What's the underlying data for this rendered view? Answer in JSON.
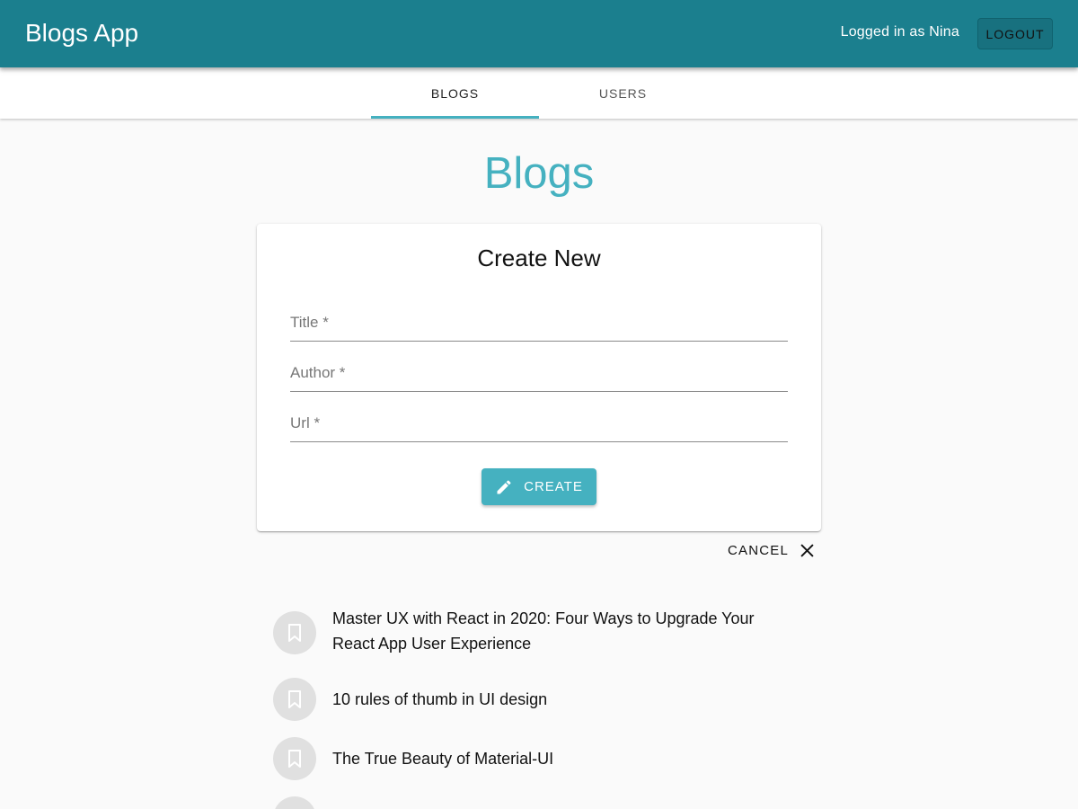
{
  "appbar": {
    "title": "Blogs App",
    "logged_in_text": "Logged in as Nina",
    "logout_label": "LOGOUT"
  },
  "tabs": [
    {
      "label": "BLOGS",
      "selected": true
    },
    {
      "label": "USERS",
      "selected": false
    }
  ],
  "page": {
    "heading": "Blogs"
  },
  "form": {
    "title": "Create New",
    "fields": [
      {
        "label": "Title *",
        "value": ""
      },
      {
        "label": "Author *",
        "value": ""
      },
      {
        "label": "Url *",
        "value": ""
      }
    ],
    "create_label": "CREATE",
    "create_icon": "pencil-icon",
    "cancel_label": "CANCEL",
    "cancel_icon": "close-icon"
  },
  "blogs": [
    {
      "title": "Master UX with React in 2020: Four Ways to Upgrade Your React App User Experience",
      "icon": "bookmark-icon"
    },
    {
      "title": "10 rules of thumb in UI design",
      "icon": "bookmark-icon"
    },
    {
      "title": "The True Beauty of Material-UI",
      "icon": "bookmark-icon"
    },
    {
      "title": "",
      "icon": "bookmark-icon"
    }
  ],
  "colors": {
    "appbar": "#1b7f8e",
    "accent": "#45b1c0",
    "background": "#fafafa"
  }
}
